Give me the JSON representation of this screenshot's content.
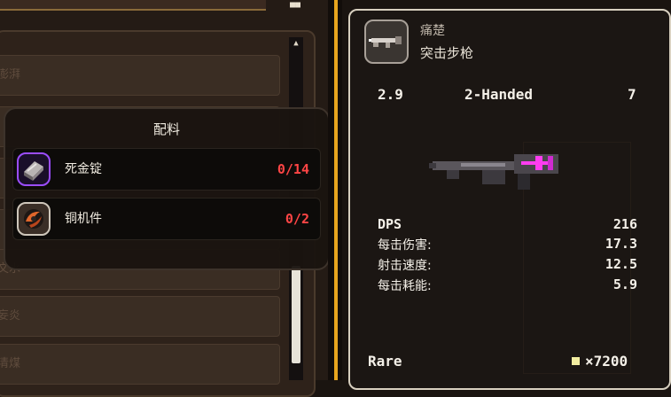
{
  "top_bar": {
    "corner_glyph": "■■"
  },
  "background_list": {
    "rows": [
      "澎湃",
      "",
      "",
      "",
      "文水",
      "妄炎",
      "清煤"
    ]
  },
  "scrollbar": {
    "arrow": "▲",
    "position": 0.75
  },
  "recipe_popup": {
    "title": "配料",
    "materials": [
      {
        "name": "死金锭",
        "count": "0/14",
        "icon": "deathmetal-ingot-icon",
        "border_color": "#9b4dff"
      },
      {
        "name": "铜机件",
        "count": "0/2",
        "icon": "copper-part-icon",
        "border_color": "#cfc7bb"
      }
    ]
  },
  "weapon": {
    "name": "痛楚",
    "type": "突击步枪",
    "icon": "assault-rifle-icon",
    "header_stats": {
      "left": "2.9",
      "center": "2-Handed",
      "right": "7"
    },
    "stats": [
      {
        "label": "DPS",
        "value": "216"
      },
      {
        "label": "每击伤害:",
        "value": "17.3"
      },
      {
        "label": "射击速度:",
        "value": "12.5"
      },
      {
        "label": "每击耗能:",
        "value": "5.9"
      }
    ],
    "rarity": "Rare",
    "price": "×7200",
    "accent_color": "#ff3df0"
  }
}
